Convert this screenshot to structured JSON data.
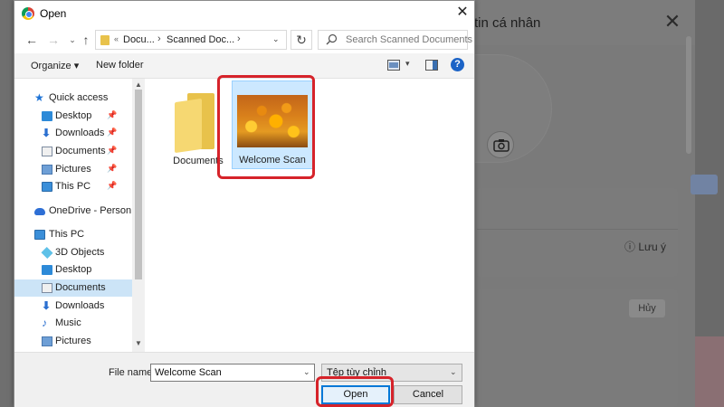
{
  "dialog": {
    "title": "Open",
    "nav": {
      "breadcrumb": [
        "Docu...",
        "Scanned Doc..."
      ],
      "search_placeholder": "Search Scanned Documents"
    },
    "toolbar": {
      "organize_label": "Organize",
      "new_folder_label": "New folder"
    },
    "sidebar": {
      "items": [
        {
          "label": "Quick access",
          "icon": "star-icon",
          "pinned": false
        },
        {
          "label": "Desktop",
          "icon": "desktop-icon",
          "pinned": true
        },
        {
          "label": "Downloads",
          "icon": "download-icon",
          "pinned": true
        },
        {
          "label": "Documents",
          "icon": "documents-icon",
          "pinned": true
        },
        {
          "label": "Pictures",
          "icon": "pictures-icon",
          "pinned": true
        },
        {
          "label": "This PC",
          "icon": "pc-icon",
          "pinned": true
        },
        {
          "label": "OneDrive - Person",
          "icon": "onedrive-icon",
          "pinned": false
        },
        {
          "label": "This PC",
          "icon": "pc-icon",
          "pinned": false
        },
        {
          "label": "3D Objects",
          "icon": "3d-objects-icon",
          "pinned": false
        },
        {
          "label": "Desktop",
          "icon": "desktop-icon",
          "pinned": false
        },
        {
          "label": "Documents",
          "icon": "documents-icon",
          "pinned": false,
          "selected": true
        },
        {
          "label": "Downloads",
          "icon": "download-icon",
          "pinned": false
        },
        {
          "label": "Music",
          "icon": "music-icon",
          "pinned": false
        },
        {
          "label": "Pictures",
          "icon": "pictures-icon",
          "pinned": false
        }
      ]
    },
    "files": [
      {
        "name": "Documents",
        "type": "folder"
      },
      {
        "name": "Welcome Scan",
        "type": "image",
        "selected": true
      }
    ],
    "footer": {
      "file_name_label": "File name:",
      "file_name_value": "Welcome Scan",
      "file_type_value": "Tệp tùy chỉnh",
      "open_label": "Open",
      "cancel_label": "Cancel"
    }
  },
  "background": {
    "modal_title": "tin cá nhân",
    "note_label": "Lưu ý",
    "cancel_label": "Hủy"
  },
  "colors": {
    "highlight": "#d6232a",
    "selection": "#cce8ff",
    "accent": "#0078d7"
  }
}
